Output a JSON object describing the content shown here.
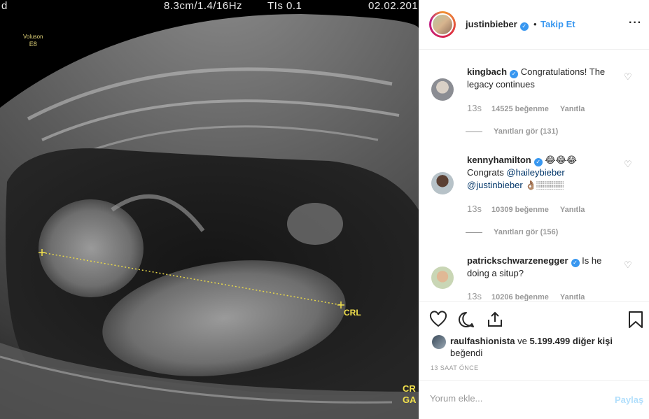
{
  "media": {
    "top_left": "d",
    "scan_params": "8.3cm/1.4/16Hz",
    "tis": "TIs 0.1",
    "date": "02.02.201",
    "probe_name": "Voluson",
    "probe_model": "E8",
    "measure_label": "CRL",
    "corner_line1": "CR",
    "corner_line2": "GA"
  },
  "header": {
    "username": "justinbieber",
    "dot": "•",
    "follow_label": "Takip Et",
    "more_icon": "more-dots-icon",
    "more_glyph": "···"
  },
  "comments": [
    {
      "username": "kingbach",
      "text": "Congratulations! The legacy continues",
      "time": "13s",
      "likes": "14525 beğenme",
      "reply_label": "Yanıtla",
      "view_replies": "Yanıtları gör (131)"
    },
    {
      "username": "kennyhamilton",
      "emoji": "😂😂😂",
      "text_prefix": "Congrats",
      "mention1": "@haileybieber",
      "mention2": "@justinbieber",
      "text_suffix": "👌🏽🏽🏽🏽",
      "time": "13s",
      "likes": "10309 beğenme",
      "reply_label": "Yanıtla",
      "view_replies": "Yanıtları gör (156)"
    },
    {
      "username": "patrickschwarzenegger",
      "text": "Is he doing a situp?",
      "time": "13s",
      "likes": "10206 beğenme",
      "reply_label": "Yanıtla"
    }
  ],
  "likes": {
    "user": "raulfashionista",
    "connector": "ve",
    "others": "5.199.499 diğer kişi",
    "suffix": "beğendi"
  },
  "timestamp": "13 SAAT ÖNCE",
  "comment_box": {
    "placeholder": "Yorum ekle...",
    "post_label": "Paylaş"
  },
  "colors": {
    "accent": "#3897f0",
    "verified": "#3897f0",
    "crl_yellow": "#f2e14d"
  }
}
